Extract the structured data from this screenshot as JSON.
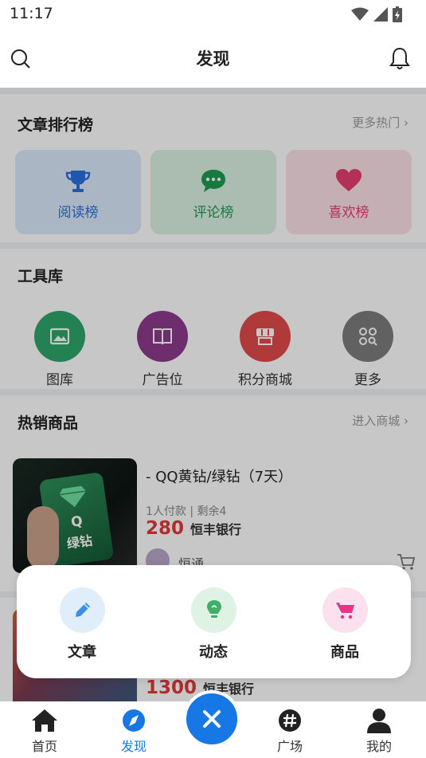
{
  "status_bar": {
    "time": "11:17"
  },
  "header": {
    "title": "发现",
    "search_icon": "search-icon",
    "bell_icon": "bell-icon"
  },
  "rankings": {
    "title": "文章排行榜",
    "more": "更多热门",
    "items": [
      {
        "label": "阅读榜",
        "icon": "trophy-icon",
        "color": "#2a6fdb",
        "bg": "#dce9fb"
      },
      {
        "label": "评论榜",
        "icon": "chat-bubble-icon",
        "color": "#1e9a52",
        "bg": "#dcf1e3"
      },
      {
        "label": "喜欢榜",
        "icon": "heart-icon",
        "color": "#e63e72",
        "bg": "#fbe0e8"
      }
    ]
  },
  "tools": {
    "title": "工具库",
    "items": [
      {
        "label": "图库",
        "icon": "image-icon",
        "color": "#2ea66a"
      },
      {
        "label": "广告位",
        "icon": "book-icon",
        "color": "#8e3a8c"
      },
      {
        "label": "积分商城",
        "icon": "store-icon",
        "color": "#e24a4a"
      },
      {
        "label": "更多",
        "icon": "grid-icon",
        "color": "#7d7d7d"
      }
    ]
  },
  "products": {
    "title": "热销商品",
    "more": "进入商城",
    "items": [
      {
        "name": "- QQ黄钻/绿钻（7天）",
        "meta": "1人付款 | 剩余4",
        "price": "280",
        "unit": "恒丰银行",
        "seller": "恒通",
        "card_text_top": "Q",
        "card_text_bottom": "绿钻"
      },
      {
        "price": "1300",
        "unit": "恒丰银行"
      }
    ]
  },
  "popup": {
    "items": [
      {
        "label": "文章",
        "icon": "pencil-icon",
        "color": "#3b8de6",
        "bg": "#e0eefb"
      },
      {
        "label": "动态",
        "icon": "lightbulb-icon",
        "color": "#3fae6a",
        "bg": "#dff3e5"
      },
      {
        "label": "商品",
        "icon": "cart-icon",
        "color": "#e8338a",
        "bg": "#fbe1ee"
      }
    ]
  },
  "tabbar": {
    "items": [
      {
        "label": "首页",
        "icon": "home-icon",
        "active": false
      },
      {
        "label": "发现",
        "icon": "compass-icon",
        "active": true
      },
      {
        "label": "广场",
        "icon": "hashtag-icon",
        "active": false
      },
      {
        "label": "我的",
        "icon": "user-icon",
        "active": false
      }
    ],
    "center_icon": "close-icon",
    "accent": "#1677e5"
  }
}
